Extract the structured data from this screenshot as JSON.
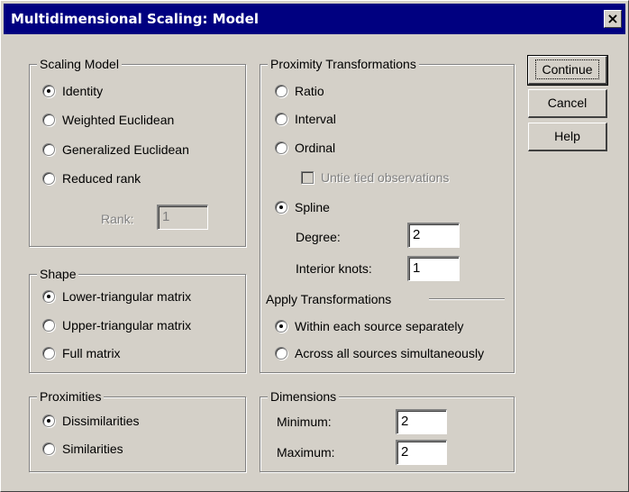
{
  "window": {
    "title": "Multidimensional Scaling: Model",
    "close_label": "×"
  },
  "scaling_model": {
    "legend": "Scaling Model",
    "options": [
      "Identity",
      "Weighted Euclidean",
      "Generalized Euclidean",
      "Reduced rank"
    ],
    "selected": "Identity",
    "rank_label": "Rank:",
    "rank_value": "1"
  },
  "shape": {
    "legend": "Shape",
    "options": [
      "Lower-triangular matrix",
      "Upper-triangular matrix",
      "Full matrix"
    ],
    "selected": "Lower-triangular matrix"
  },
  "proximities": {
    "legend": "Proximities",
    "options": [
      "Dissimilarities",
      "Similarities"
    ],
    "selected": "Dissimilarities"
  },
  "proximity_transformations": {
    "legend": "Proximity Transformations",
    "options": [
      "Ratio",
      "Interval",
      "Ordinal",
      "Spline"
    ],
    "selected": "Spline",
    "untie_label": "Untie tied observations",
    "degree_label": "Degree:",
    "degree_value": "2",
    "knots_label": "Interior knots:",
    "knots_value": "1",
    "apply_label": "Apply Transformations",
    "apply_options": [
      "Within each source separately",
      "Across all sources simultaneously"
    ],
    "apply_selected": "Within each source separately"
  },
  "dimensions": {
    "legend": "Dimensions",
    "minimum_label": "Minimum:",
    "minimum_value": "2",
    "maximum_label": "Maximum:",
    "maximum_value": "2"
  },
  "buttons": {
    "continue": "Continue",
    "cancel": "Cancel",
    "help": "Help"
  }
}
